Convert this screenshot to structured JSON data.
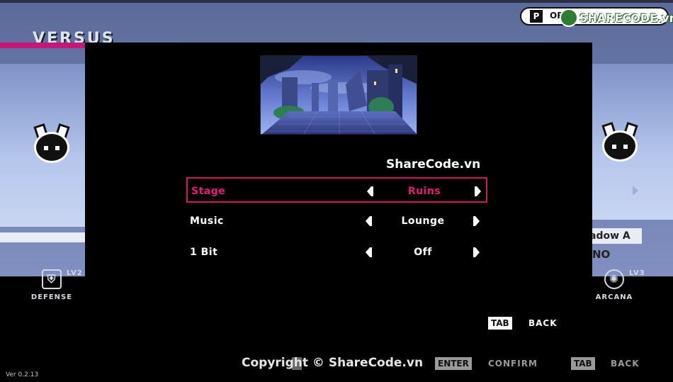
{
  "hud": {
    "p_label": "P",
    "text": "OP"
  },
  "versus_title": "VERSUS",
  "right_name_tag": "adow A",
  "right_no_text": "NO",
  "stats": {
    "defense": {
      "label": "DEFENSE",
      "level": "LV2"
    },
    "arcana": {
      "label": "ARCANA",
      "level": "LV3"
    }
  },
  "version": "Ver 0.2.13",
  "watermark": "ShareCode.vn",
  "logo_text": "SHARECODE.vn",
  "copyright": "Copyright © ShareCode.vn",
  "options": [
    {
      "label": "Stage",
      "value": "Ruins",
      "selected": true
    },
    {
      "label": "Music",
      "value": "Lounge",
      "selected": false
    },
    {
      "label": "1 Bit",
      "value": "Off",
      "selected": false
    }
  ],
  "modal_hint": {
    "key": "TAB",
    "action": "BACK"
  },
  "footer_hints": [
    {
      "key": "ENTER",
      "action": "CONFIRM"
    },
    {
      "key": "TAB",
      "action": "BACK"
    }
  ],
  "colors": {
    "accent": "#e8197a",
    "border": "#d1185f",
    "versus_bar": "#c4177a"
  }
}
